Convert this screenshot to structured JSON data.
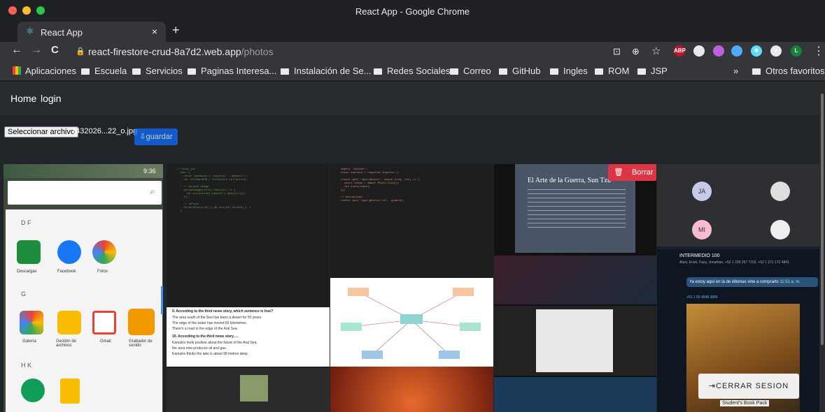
{
  "window": {
    "title": "React App - Google Chrome"
  },
  "tab": {
    "label": "React App",
    "close": "×",
    "new": "+"
  },
  "toolbar": {
    "host": "react-firestore-crud-8a7d2.web.app",
    "path": "/photos",
    "back": "←",
    "forward": "→",
    "reload": "C",
    "lock": "🔒",
    "translate": "⊡",
    "zoom": "⊕",
    "star": "☆",
    "menu": "⋮"
  },
  "extensions": [
    {
      "name": "abp-icon",
      "label": "ABP",
      "color": "#c8102e"
    },
    {
      "name": "cube-icon",
      "label": "",
      "color": "#e8eaed"
    },
    {
      "name": "circle-ext-icon",
      "label": "",
      "color": "#c05ee0"
    },
    {
      "name": "ring-ext-icon",
      "label": "",
      "color": "#4dabf7"
    },
    {
      "name": "react-ext-icon",
      "label": "⚛",
      "color": "#61dafb"
    },
    {
      "name": "puzzle-icon",
      "label": "✦",
      "color": "#e8eaed"
    },
    {
      "name": "profile-avatar",
      "label": "L",
      "color": "#188038"
    }
  ],
  "bookmarks": {
    "items": [
      "Aplicaciones",
      "Escuela",
      "Servicios",
      "Paginas Interesa...",
      "Instalación de Se...",
      "Redes Sociales",
      "Correo",
      "GitHub",
      "Ingles",
      "ROM",
      "JSP"
    ],
    "more": "»",
    "other": "Otros favoritos"
  },
  "nav": {
    "home": "Home",
    "login": "login"
  },
  "upload": {
    "choose": "Seleccionar archivo",
    "filename": "1432026...22_o.jpg",
    "save": "guardar",
    "save_icon": "⇩"
  },
  "photos": {
    "delete": "Borrar",
    "delete_icon": "🗑",
    "logout": "CERRAR SESION",
    "logout_icon": "⇥"
  },
  "screenshot_texts": {
    "phone_time": "9:36",
    "sec_d": "D F",
    "sec_g": "G",
    "sec_h": "H K",
    "apps1": [
      "Descargas",
      "Facebook",
      "Fotos"
    ],
    "apps2": [
      "Galería",
      "Gestión de archivos",
      "Gmail",
      "Grabador de sonido"
    ],
    "book_title": "El Arte de la Guerra, Sun Tzu",
    "quiz_q9": "9. According to the third news story, which sentence is true?",
    "quiz_a": "The area south of the Sea has been a desert for 50 years.",
    "quiz_b": "The edge of the water has moved 60 kilometres.",
    "quiz_c": "There's a road to the edge of the Aral Sea.",
    "quiz_q10": "10. According to the third news story, ...",
    "quiz_d": "Kamalov feels positive about the future of the Aral Sea.",
    "quiz_e": "the area now produces oil and gas.",
    "quiz_f": "Kamalov thinks the lake is about 90 metres deep.",
    "chat_title": "INTERMEDIO 100",
    "chat_members": "Alexi, Enoh, Fany, Jonathan, +52 1 228 257 7102, +52 1 271 172 4841",
    "chat_msg": "Ya estoy aquí en la de idiomas vine a comprarlo",
    "chat_time": "11:51 a. m.",
    "chat_phone": "+52 1 55 4848 3895",
    "book_cover": "Student's Book Pack"
  },
  "colors": {
    "accent": "#0d6efd",
    "danger": "#dc3545"
  }
}
